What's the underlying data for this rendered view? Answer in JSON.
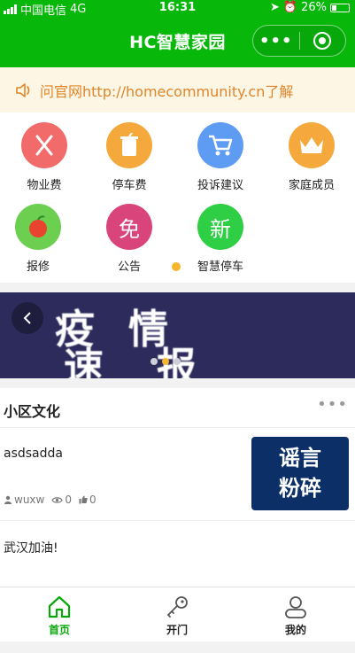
{
  "status": {
    "carrier": "中国电信",
    "network": "4G",
    "time": "16:31",
    "battery": "26%"
  },
  "nav": {
    "title": "HC智慧家园",
    "more": "•••"
  },
  "notice": {
    "text": "问官网http://homecommunity.cn了解"
  },
  "grid": [
    {
      "label": "物业费",
      "icon": "fork-knife-icon",
      "color": "#f26b6b"
    },
    {
      "label": "停车费",
      "icon": "cup-icon",
      "color": "#f5a83c"
    },
    {
      "label": "投诉建议",
      "icon": "cart-icon",
      "color": "#5d9cf2"
    },
    {
      "label": "家庭成员",
      "icon": "crown-icon",
      "color": "#f5a83c"
    },
    {
      "label": "报修",
      "icon": "apple-icon",
      "color": "#6ccf4f"
    },
    {
      "label": "公告",
      "glyph": "免",
      "color": "#d9447b"
    },
    {
      "label": "智慧停车",
      "glyph": "新",
      "color": "#2fcf45"
    }
  ],
  "banner": {
    "line1": "疫情",
    "line2": "速报"
  },
  "culture": {
    "title": "小区文化",
    "articles": [
      {
        "title": "asdsadda",
        "author": "wuxw",
        "views": "0",
        "likes": "0",
        "thumb_line1": "谣言",
        "thumb_line2": "粉碎"
      },
      {
        "title": "武汉加油!"
      }
    ]
  },
  "tabs": [
    {
      "label": "首页",
      "icon": "home-icon"
    },
    {
      "label": "开门",
      "icon": "key-icon"
    },
    {
      "label": "我的",
      "icon": "user-icon"
    }
  ],
  "colors": {
    "primary": "#07b80a",
    "notice_text": "#e0852a",
    "notice_bg": "#fdf6e4",
    "accent_dot": "#f5b52c"
  }
}
